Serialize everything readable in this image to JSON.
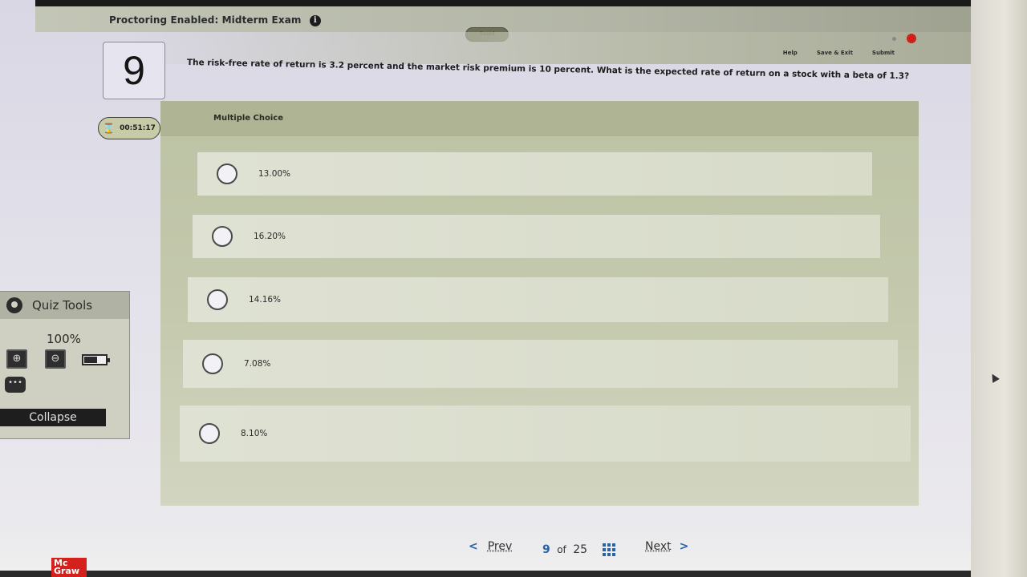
{
  "header": {
    "title": "Proctoring Enabled: Midterm Exam",
    "info_icon": "info-icon",
    "saved_label": "Saved",
    "links": [
      "Help",
      "Save & Exit",
      "Submit"
    ]
  },
  "question": {
    "number": "9",
    "timer": "00:51:17",
    "text": "The risk-free rate of return is 3.2 percent and the market risk premium is 10 percent. What is the expected rate of return on a stock with a beta of 1.3?",
    "type_label": "Multiple Choice",
    "choices": [
      {
        "label": "13.00%",
        "selected": false
      },
      {
        "label": "16.20%",
        "selected": false
      },
      {
        "label": "14.16%",
        "selected": false
      },
      {
        "label": "7.08%",
        "selected": false
      },
      {
        "label": "8.10%",
        "selected": false
      }
    ]
  },
  "quiz_tools": {
    "title": "Quiz Tools",
    "zoom_level": "100%",
    "tools": [
      "zoom-in-icon",
      "zoom-out-icon",
      "battery-icon",
      "chat-icon"
    ],
    "collapse_label": "Collapse"
  },
  "navigation": {
    "prev_label": "Prev",
    "next_label": "Next",
    "current_page": "9",
    "of_label": "of",
    "total_pages": "25"
  },
  "brand": {
    "logo_text": "Mc Graw",
    "logo_color": "#d4211c",
    "accent_color": "#2a62a6"
  }
}
